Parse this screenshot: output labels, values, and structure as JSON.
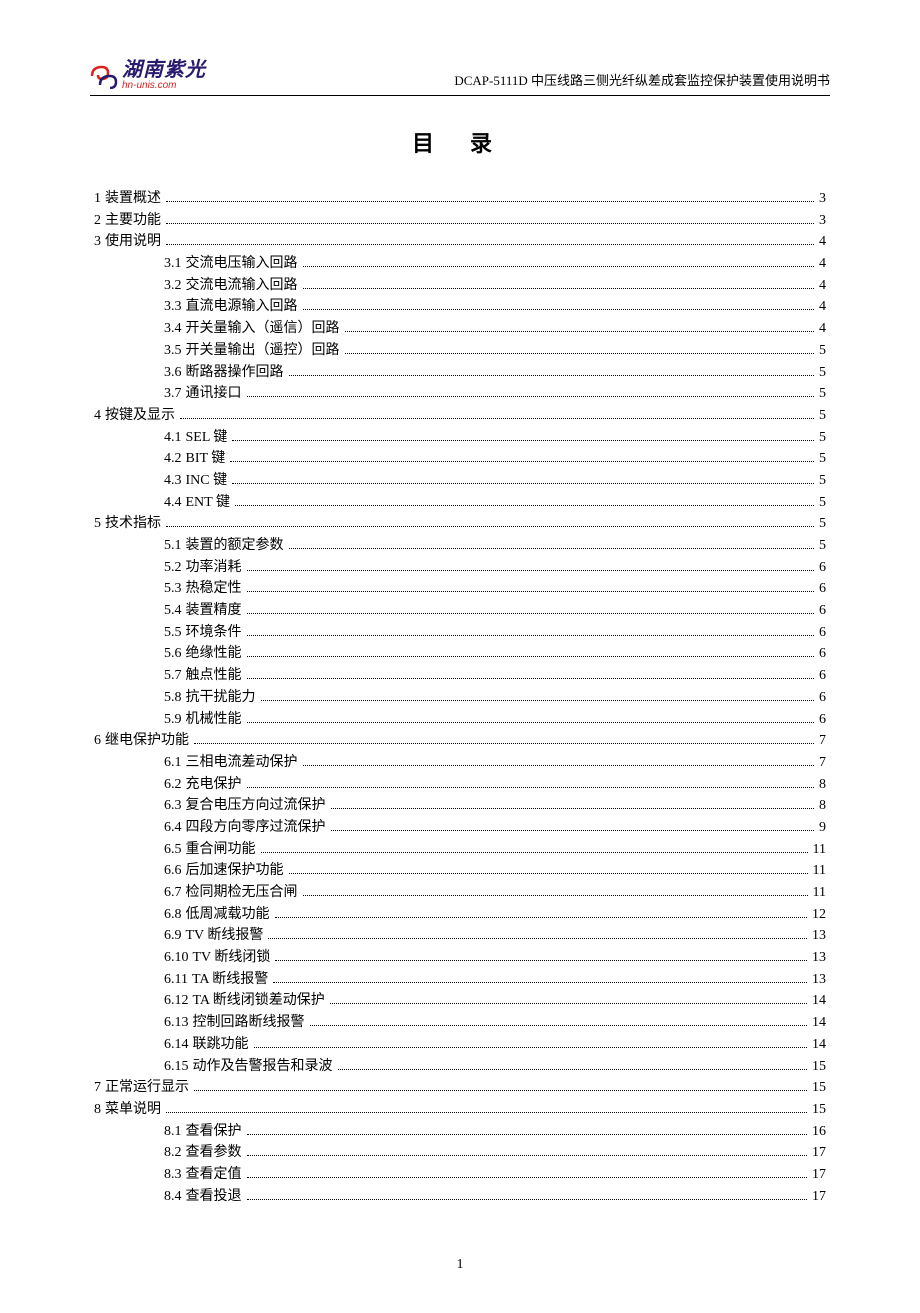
{
  "header": {
    "logo_cn": "湖南紫光",
    "logo_url": "hn-unis.com",
    "doc_title": "DCAP-5111D 中压线路三侧光纤纵差成套监控保护装置使用说明书"
  },
  "toc_title": "目录",
  "page_number": "1",
  "toc": [
    {
      "level": 1,
      "num": "1",
      "label": "装置概述",
      "page": "3"
    },
    {
      "level": 1,
      "num": "2",
      "label": "主要功能",
      "page": "3"
    },
    {
      "level": 1,
      "num": "3",
      "label": "使用说明",
      "page": "4"
    },
    {
      "level": 2,
      "num": "3.1",
      "label": "交流电压输入回路",
      "page": "4"
    },
    {
      "level": 2,
      "num": "3.2",
      "label": "交流电流输入回路",
      "page": "4"
    },
    {
      "level": 2,
      "num": "3.3",
      "label": "直流电源输入回路",
      "page": "4"
    },
    {
      "level": 2,
      "num": "3.4",
      "label": "开关量输入（遥信）回路",
      "page": "4"
    },
    {
      "level": 2,
      "num": "3.5",
      "label": "开关量输出（遥控）回路",
      "page": "5"
    },
    {
      "level": 2,
      "num": "3.6",
      "label": "断路器操作回路",
      "page": "5"
    },
    {
      "level": 2,
      "num": "3.7",
      "label": "通讯接口",
      "page": "5"
    },
    {
      "level": 1,
      "num": "4",
      "label": "按键及显示",
      "page": "5"
    },
    {
      "level": 2,
      "num": "4.1",
      "label": "SEL 键",
      "page": "5"
    },
    {
      "level": 2,
      "num": "4.2",
      "label": "BIT 键",
      "page": "5"
    },
    {
      "level": 2,
      "num": "4.3",
      "label": "INC 键",
      "page": "5"
    },
    {
      "level": 2,
      "num": "4.4",
      "label": "ENT 键",
      "page": "5"
    },
    {
      "level": 1,
      "num": "5",
      "label": "技术指标",
      "page": "5"
    },
    {
      "level": 2,
      "num": "5.1",
      "label": "装置的额定参数",
      "page": "5"
    },
    {
      "level": 2,
      "num": "5.2",
      "label": "功率消耗",
      "page": "6"
    },
    {
      "level": 2,
      "num": "5.3",
      "label": "热稳定性",
      "page": "6"
    },
    {
      "level": 2,
      "num": "5.4",
      "label": "装置精度",
      "page": "6"
    },
    {
      "level": 2,
      "num": "5.5",
      "label": "环境条件",
      "page": "6"
    },
    {
      "level": 2,
      "num": "5.6",
      "label": "绝缘性能",
      "page": "6"
    },
    {
      "level": 2,
      "num": "5.7",
      "label": "触点性能",
      "page": "6"
    },
    {
      "level": 2,
      "num": "5.8",
      "label": "抗干扰能力",
      "page": "6"
    },
    {
      "level": 2,
      "num": "5.9",
      "label": "机械性能",
      "page": "6"
    },
    {
      "level": 1,
      "num": "6",
      "label": "继电保护功能",
      "page": "7"
    },
    {
      "level": 2,
      "num": "6.1",
      "label": "三相电流差动保护",
      "page": "7"
    },
    {
      "level": 2,
      "num": "6.2",
      "label": "充电保护",
      "page": "8"
    },
    {
      "level": 2,
      "num": "6.3",
      "label": "复合电压方向过流保护",
      "page": "8"
    },
    {
      "level": 2,
      "num": "6.4",
      "label": "四段方向零序过流保护",
      "page": "9"
    },
    {
      "level": 2,
      "num": "6.5",
      "label": "重合闸功能",
      "page": "11"
    },
    {
      "level": 2,
      "num": "6.6",
      "label": "后加速保护功能",
      "page": "11"
    },
    {
      "level": 2,
      "num": "6.7",
      "label": "检同期检无压合闸",
      "page": "11"
    },
    {
      "level": 2,
      "num": "6.8",
      "label": "低周减载功能",
      "page": "12"
    },
    {
      "level": 2,
      "num": "6.9",
      "label": "TV 断线报警",
      "page": "13"
    },
    {
      "level": 2,
      "num": "6.10",
      "label": "TV 断线闭锁",
      "page": "13"
    },
    {
      "level": 2,
      "num": "6.11",
      "label": "TA 断线报警",
      "page": "13"
    },
    {
      "level": 2,
      "num": "6.12",
      "label": "TA 断线闭锁差动保护",
      "page": "14"
    },
    {
      "level": 2,
      "num": "6.13",
      "label": "控制回路断线报警",
      "page": "14"
    },
    {
      "level": 2,
      "num": "6.14",
      "label": "联跳功能",
      "page": "14"
    },
    {
      "level": 2,
      "num": "6.15",
      "label": "动作及告警报告和录波",
      "page": "15"
    },
    {
      "level": 1,
      "num": "7",
      "label": "正常运行显示",
      "page": "15"
    },
    {
      "level": 1,
      "num": "8",
      "label": "菜单说明",
      "page": "15"
    },
    {
      "level": 2,
      "num": "8.1",
      "label": "查看保护",
      "page": "16"
    },
    {
      "level": 2,
      "num": "8.2",
      "label": "查看参数",
      "page": "17"
    },
    {
      "level": 2,
      "num": "8.3",
      "label": "查看定值",
      "page": "17"
    },
    {
      "level": 2,
      "num": "8.4",
      "label": "查看投退",
      "page": "17"
    }
  ]
}
